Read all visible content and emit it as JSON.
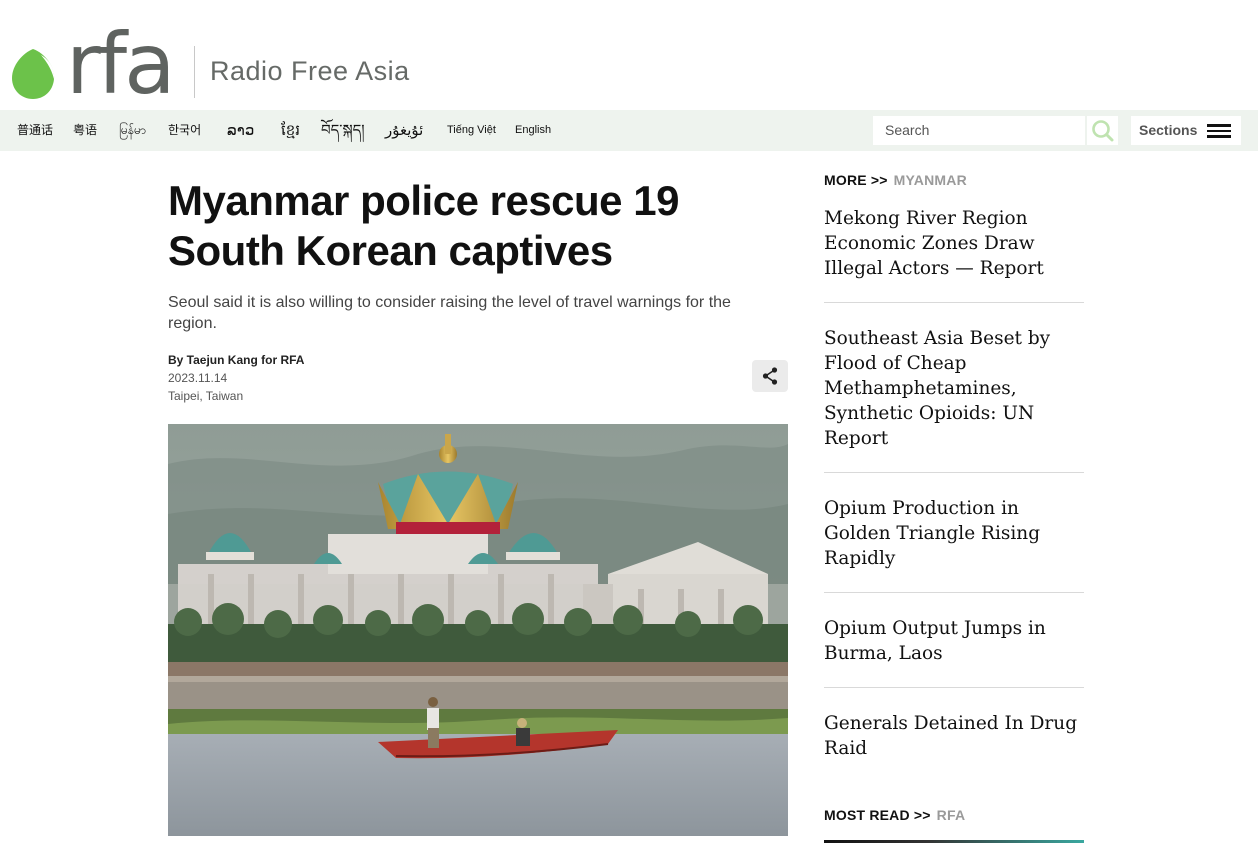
{
  "header": {
    "logo_text": "rfa",
    "brand_name": "Radio Free Asia",
    "brand_color": "#6cc24a"
  },
  "nav": {
    "languages": [
      "普通话",
      "粤语",
      "မြန်မာ",
      "한국어",
      "ລາວ",
      "ខ្មែរ",
      "བོད་སྐད།",
      "ئۇيغۇر",
      "Tiếng Việt",
      "English"
    ],
    "search_placeholder": "Search",
    "search_icon": "search-icon",
    "sections_label": "Sections",
    "menu_icon": "hamburger-menu-icon"
  },
  "article": {
    "title": "Myanmar police rescue 19 South Korean captives",
    "subtitle": "Seoul said it is also willing to consider raising the level of travel warnings for the region.",
    "byline": "By Taejun Kang for RFA",
    "date": "2023.11.14",
    "location": "Taipei, Taiwan",
    "share_icon": "share-icon",
    "photo_subject": "Kings Romans casino with crown dome on Mekong riverbank, fishermen in red boat"
  },
  "sidebar": {
    "more_label": "MORE >>",
    "more_section": "MYANMAR",
    "items": [
      "Mekong River Region Economic Zones Draw Illegal Actors — Report",
      "Southeast Asia Beset by Flood of Cheap Methamphetamines, Synthetic Opioids: UN Report",
      "Opium Production in Golden Triangle Rising Rapidly",
      "Opium Output Jumps in Burma, Laos",
      "Generals Detained In Drug Raid"
    ],
    "most_read_label": "MOST READ >>",
    "most_read_section": "RFA"
  }
}
